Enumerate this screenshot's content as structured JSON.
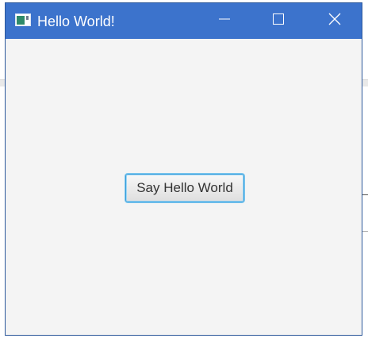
{
  "window": {
    "title": "Hello World!",
    "controls": {
      "minimize": "minimize-icon",
      "maximize": "maximize-icon",
      "close": "close-icon"
    },
    "titlebar_color": "#3c73cc"
  },
  "content": {
    "button_label": "Say Hello World"
  }
}
